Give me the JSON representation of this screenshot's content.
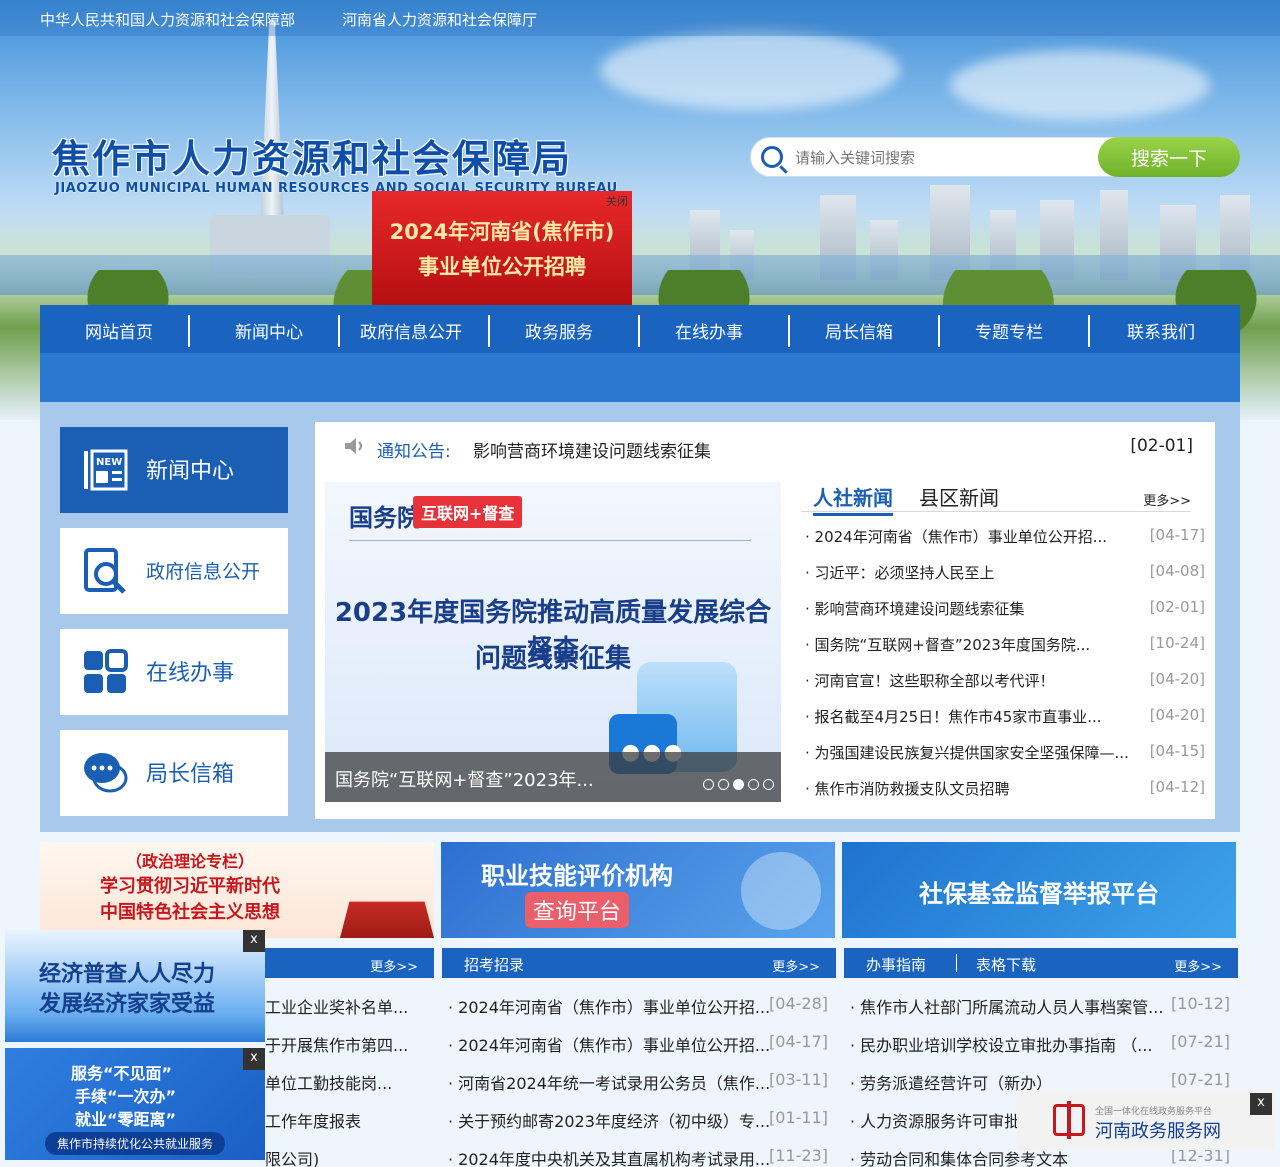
{
  "top_links": [
    "中华人民共和国人力资源和社会保障部",
    "河南省人力资源和社会保障厅"
  ],
  "site": {
    "title": "焦作市人力资源和社会保障局",
    "subtitle": "JIAOZUO MUNICIPAL HUMAN RESOURCES AND SOCIAL SECURITY BUREAU"
  },
  "search": {
    "placeholder": "请输入关键词搜索",
    "button": "搜索一下"
  },
  "promo": {
    "close": "关闭",
    "line1": "2024年河南省(焦作市)",
    "line2": "事业单位公开招聘"
  },
  "nav": [
    "网站首页",
    "新闻中心",
    "政府信息公开",
    "政务服务",
    "在线办事",
    "局长信箱",
    "专题专栏",
    "联系我们"
  ],
  "side": [
    {
      "label": "新闻中心",
      "icon": "newspaper-icon"
    },
    {
      "label": "政府信息公开",
      "icon": "document-search-icon"
    },
    {
      "label": "在线办事",
      "icon": "grid-apps-icon"
    },
    {
      "label": "局长信箱",
      "icon": "chat-bubble-icon"
    }
  ],
  "notice": {
    "label": "通知公告:",
    "text": "影响营商环境建设问题线索征集",
    "date": "[02-01]"
  },
  "slide": {
    "org": "国务院",
    "tag": "互联网+督查",
    "headline1": "2023年度国务院推动高质量发展综合督查",
    "headline2": "问题线索征集",
    "caption": "国务院“互联网+督查”2023年..."
  },
  "news_tabs": {
    "active": "人社新闻",
    "other": "县区新闻",
    "more": "更多>>"
  },
  "news": [
    {
      "title": "· 2024年河南省（焦作市）事业单位公开招...",
      "date": "[04-17]"
    },
    {
      "title": "· 习近平：必须坚持人民至上",
      "date": "[04-08]"
    },
    {
      "title": "· 影响营商环境建设问题线索征集",
      "date": "[02-01]"
    },
    {
      "title": "· 国务院“互联网+督查”2023年度国务院...",
      "date": "[10-24]"
    },
    {
      "title": "· 河南官宣！这些职称全部以考代评！",
      "date": "[04-20]"
    },
    {
      "title": "· 报名截至4月25日！焦作市45家市直事业...",
      "date": "[04-20]"
    },
    {
      "title": "· 为强国建设民族复兴提供国家安全坚强保障—...",
      "date": "[04-15]"
    },
    {
      "title": "· 焦作市消防救援支队文员招聘",
      "date": "[04-12]"
    }
  ],
  "ads": {
    "theory": {
      "l1": "（政治理论专栏）",
      "l2": "学习贯彻习近平新时代",
      "l3": "中国特色社会主义思想"
    },
    "skill": {
      "l1": "职业技能评价机构",
      "l2": "查询平台"
    },
    "fund": {
      "l1": "社保基金监督举报平台"
    }
  },
  "col1": {
    "more": "更多>>",
    "items": [
      {
        "title": "工业企业奖补名单..."
      },
      {
        "title": "于开展焦作市第四..."
      },
      {
        "title": "单位工勤技能岗..."
      },
      {
        "title": "工作年度报表"
      },
      {
        "title": "限公司)"
      }
    ]
  },
  "col2": {
    "title": "招考招录",
    "more": "更多>>",
    "items": [
      {
        "title": "· 2024年河南省（焦作市）事业单位公开招...",
        "date": "[04-28]"
      },
      {
        "title": "· 2024年河南省（焦作市）事业单位公开招...",
        "date": "[04-17]"
      },
      {
        "title": "· 河南省2024年统一考试录用公务员（焦作...",
        "date": "[03-11]"
      },
      {
        "title": "· 关于预约邮寄2023年度经济（初中级）专...",
        "date": "[01-11]"
      },
      {
        "title": "· 2024年度中央机关及其直属机构考试录用...",
        "date": "[11-23]"
      }
    ]
  },
  "col3": {
    "tab1": "办事指南",
    "tab2": "表格下载",
    "more": "更多>>",
    "items": [
      {
        "title": "· 焦作市人社部门所属流动人员人事档案管...",
        "date": "[10-12]"
      },
      {
        "title": "· 民办职业培训学校设立审批办事指南 （...",
        "date": "[07-21]"
      },
      {
        "title": "· 劳务派遣经营许可（新办）",
        "date": "[07-21]"
      },
      {
        "title": "· 人力资源服务许可审批",
        "date": ""
      },
      {
        "title": "· 劳动合同和集体合同参考文本",
        "date": "[12-31]"
      }
    ]
  },
  "floats": {
    "census": {
      "close": "x",
      "l1": "经济普查人人尽力",
      "l2": "发展经济家家受益"
    },
    "service": {
      "close": "x",
      "l1": "服务“不见面”",
      "l2": "手续“一次办”",
      "l3": "就业“零距离”",
      "pill": "焦作市持续优化公共就业服务"
    },
    "gov": {
      "close": "x",
      "small": "全国一体化在线政务服务平台",
      "big": "河南政务服务网"
    }
  }
}
